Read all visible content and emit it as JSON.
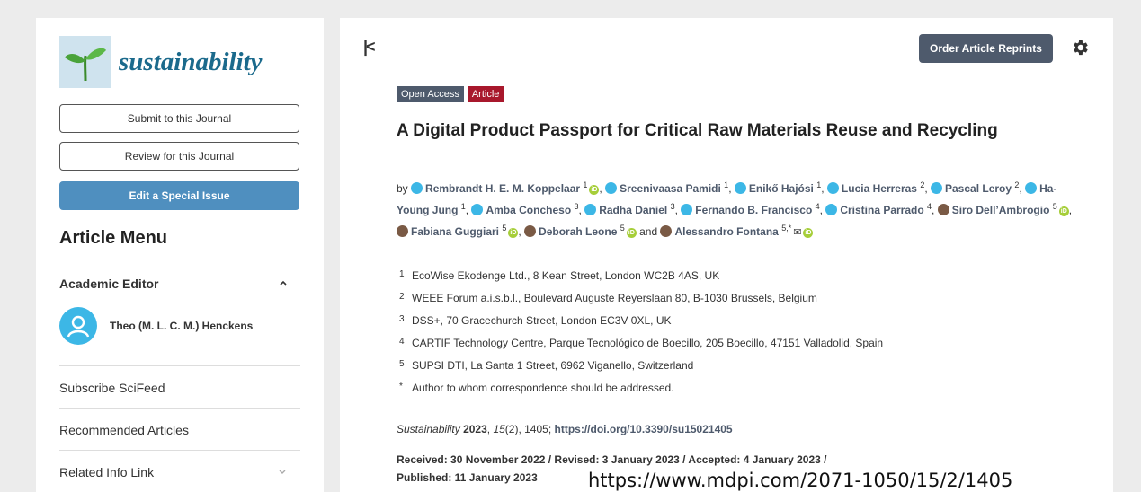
{
  "sidebar": {
    "journal_name": "sustainability",
    "submit_label": "Submit to this Journal",
    "review_label": "Review for this Journal",
    "special_issue_label": "Edit a Special Issue",
    "menu_title": "Article Menu",
    "academic_editor_label": "Academic Editor",
    "editor_name": "Theo (M. L. C. M.) Henckens",
    "subscribe_label": "Subscribe SciFeed",
    "recommended_label": "Recommended Articles",
    "related_label": "Related Info Link"
  },
  "header": {
    "reprints_label": "Order Article Reprints",
    "collapse_icon": "collapse-left-icon",
    "settings_icon": "gear-icon"
  },
  "article": {
    "badge_open_access": "Open Access",
    "badge_article": "Article",
    "title": "A Digital Product Passport for Critical Raw Materials Reuse and Recycling",
    "by": "by",
    "authors": [
      {
        "name": "Rembrandt H. E. M. Koppelaar",
        "sup": "1",
        "orcid": true,
        "photo": false
      },
      {
        "name": "Sreenivaasa Pamidi",
        "sup": "1",
        "orcid": false,
        "photo": false
      },
      {
        "name": "Enikő Hajósi",
        "sup": "1",
        "orcid": false,
        "photo": false
      },
      {
        "name": "Lucia Herreras",
        "sup": "2",
        "orcid": false,
        "photo": false
      },
      {
        "name": "Pascal Leroy",
        "sup": "2",
        "orcid": false,
        "photo": false
      },
      {
        "name": "Ha-Young Jung",
        "sup": "1",
        "orcid": false,
        "photo": false
      },
      {
        "name": "Amba Concheso",
        "sup": "3",
        "orcid": false,
        "photo": false
      },
      {
        "name": "Radha Daniel",
        "sup": "3",
        "orcid": false,
        "photo": false
      },
      {
        "name": "Fernando B. Francisco",
        "sup": "4",
        "orcid": false,
        "photo": false
      },
      {
        "name": "Cristina Parrado",
        "sup": "4",
        "orcid": false,
        "photo": false
      },
      {
        "name": "Siro Dell’Ambrogio",
        "sup": "5",
        "orcid": true,
        "photo": true
      },
      {
        "name": "Fabiana Guggiari",
        "sup": "5",
        "orcid": true,
        "photo": true
      },
      {
        "name": "Deborah Leone",
        "sup": "5",
        "orcid": true,
        "photo": true
      },
      {
        "name": "Alessandro Fontana",
        "sup": "5,*",
        "orcid": true,
        "photo": true
      }
    ],
    "and_word": "and",
    "affiliations": [
      {
        "num": "1",
        "text": "EcoWise Ekodenge Ltd., 8 Kean Street, London WC2B 4AS, UK"
      },
      {
        "num": "2",
        "text": "WEEE Forum a.i.s.b.l., Boulevard Auguste Reyerslaan 80, B-1030 Brussels, Belgium"
      },
      {
        "num": "3",
        "text": "DSS+, 70 Gracechurch Street, London EC3V 0XL, UK"
      },
      {
        "num": "4",
        "text": "CARTIF Technology Centre, Parque Tecnológico de Boecillo, 205 Boecillo, 47151 Valladolid, Spain"
      },
      {
        "num": "5",
        "text": "SUPSI DTI, La Santa 1 Street, 6962 Viganello, Switzerland"
      },
      {
        "num": "*",
        "text": "Author to whom correspondence should be addressed."
      }
    ],
    "cite_journal": "Sustainability",
    "cite_year": "2023",
    "cite_volume": "15",
    "cite_rest": "(2), 1405; ",
    "cite_doi": "https://doi.org/10.3390/su15021405",
    "dates_line1": "Received: 30 November 2022 / Revised: 3 January 2023 / Accepted: 4 January 2023 /",
    "dates_line2": "Published: 11 January 2023"
  },
  "overlay_url": "https://www.mdpi.com/2071-1050/15/2/1405"
}
